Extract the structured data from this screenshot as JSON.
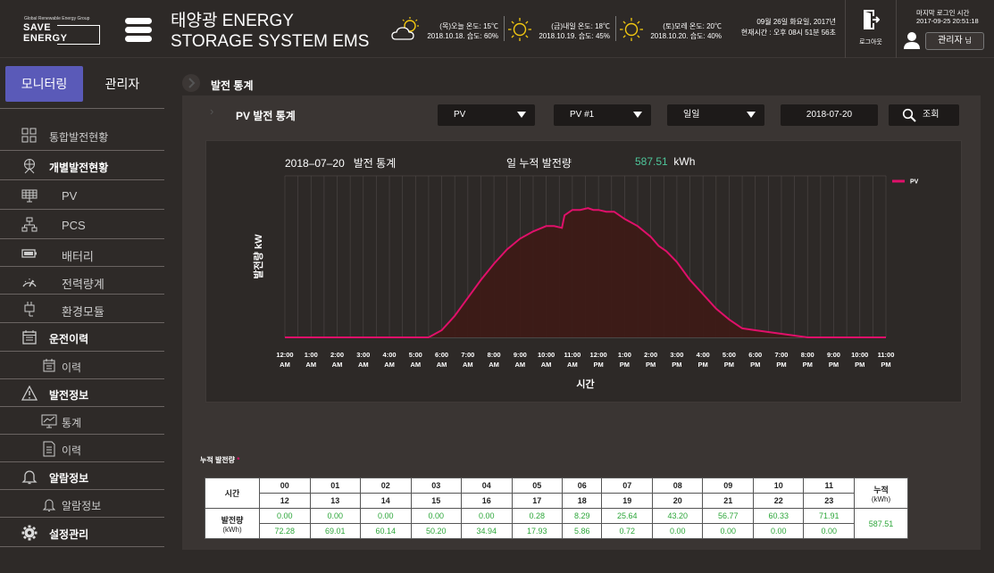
{
  "header": {
    "logo_tagline": "Global Renewable Energy Group",
    "logo_line1": "SAVE",
    "logo_line2": "ENERGY",
    "title_line1": "태양광 ENERGY",
    "title_line2": "STORAGE SYSTEM EMS",
    "weather": [
      {
        "icon": "cloud-sun-icon",
        "line1": "(목)오늘  온도: 15℃",
        "line2": "2018.10.18.  습도: 60%"
      },
      {
        "icon": "sun-icon",
        "line1": "(금)내일  온도: 18℃",
        "line2": "2018.10.19.  습도: 45%"
      },
      {
        "icon": "sun-icon",
        "line1": "(토)모레  온도: 20℃",
        "line2": "2018.10.20.  습도: 40%"
      }
    ],
    "date_line": "09월 26일 화요일, 2017년",
    "time_line": "현재시간 : 오후 08시 51분 56초",
    "logout_label": "로그아웃",
    "last_login_label": "마지막 로그인 시간",
    "last_login_value": "2017-09-25  20:51:18",
    "user_name": "관리자",
    "user_suffix": "님"
  },
  "sidebar": {
    "tab_monitoring": "모니터링",
    "tab_admin": "관리자",
    "items": [
      {
        "label": "통합발전현황",
        "icon": "grid-icon",
        "level": 1,
        "bold": false
      },
      {
        "label": "개별발전현황",
        "icon": "globe-person-icon",
        "level": 1,
        "bold": true
      },
      {
        "label": "PV",
        "icon": "solar-panel-icon",
        "level": 2,
        "bold": false
      },
      {
        "label": "PCS",
        "icon": "network-icon",
        "level": 2,
        "bold": false
      },
      {
        "label": "배터리",
        "icon": "battery-icon",
        "level": 2,
        "bold": false
      },
      {
        "label": "전력량계",
        "icon": "gauge-icon",
        "level": 2,
        "bold": false
      },
      {
        "label": "환경모듈",
        "icon": "plug-icon",
        "level": 2,
        "bold": false
      },
      {
        "label": "운전이력",
        "icon": "calendar-icon",
        "level": 1,
        "bold": true
      },
      {
        "label": "이력",
        "icon": "calendar-small-icon",
        "level": 2,
        "bold": false
      },
      {
        "label": "발전정보",
        "icon": "warning-icon",
        "level": 1,
        "bold": true
      },
      {
        "label": "통계",
        "icon": "chart-monitor-icon",
        "level": 2,
        "bold": false
      },
      {
        "label": "이력",
        "icon": "document-icon",
        "level": 2,
        "bold": false
      },
      {
        "label": "알람정보",
        "icon": "bell-icon",
        "level": 1,
        "bold": true
      },
      {
        "label": "알람정보",
        "icon": "bell-small-icon",
        "level": 2,
        "bold": false
      },
      {
        "label": "설정관리",
        "icon": "gear-icon",
        "level": 1,
        "bold": true
      }
    ]
  },
  "main": {
    "breadcrumb": "발전 통계",
    "subtitle": "PV 발전 통계",
    "filters": {
      "type": "PV",
      "device": "PV #1",
      "period": "일일",
      "date": "2018-07-20",
      "search_label": "조회"
    },
    "chart_title_date": "2018–07–20",
    "chart_title_text": "발전 통계",
    "daily_total_label": "일 누적 발전량",
    "daily_total_value": "587.51",
    "daily_total_unit": "kWh",
    "cum_label": "누적 발전량",
    "cum_mark": "*"
  },
  "chart_data": {
    "type": "area",
    "ylabel": "발전량 kW",
    "xlabel": "시간",
    "legend": "PV",
    "legend_position": "top-right",
    "colors": {
      "line": "#e0106a",
      "fill": "#3d1a16"
    },
    "grid": true,
    "ylim": [
      0,
      90
    ],
    "x_tick_labels": [
      "12:00 AM",
      "1:00 AM",
      "2:00 AM",
      "3:00 AM",
      "4:00 AM",
      "5:00 AM",
      "6:00 AM",
      "7:00 AM",
      "8:00 AM",
      "9:00 AM",
      "10:00 AM",
      "11:00 AM",
      "12:00 PM",
      "1:00 PM",
      "2:00 PM",
      "3:00 PM",
      "4:00 PM",
      "5:00 PM",
      "6:00 PM",
      "7:00 PM",
      "8:00 PM",
      "9:00 PM",
      "10:00 PM",
      "11:00 PM"
    ],
    "series": [
      {
        "name": "PV",
        "x": [
          0,
          1,
          2,
          3,
          4,
          5,
          5.5,
          6,
          6.5,
          7,
          7.5,
          8,
          8.5,
          9,
          9.5,
          10,
          10.3,
          10.6,
          10.7,
          11,
          11.3,
          11.6,
          11.8,
          12,
          12.3,
          12.6,
          13,
          13.5,
          14,
          14.3,
          14.6,
          15,
          15.5,
          16,
          16.5,
          17,
          17.5,
          18,
          18.5,
          19,
          19.5,
          20,
          21,
          22,
          23
        ],
        "y": [
          0,
          0,
          0,
          0,
          0,
          0,
          0,
          4,
          12,
          22,
          32,
          41,
          49,
          55,
          59,
          62,
          62,
          61,
          68,
          71,
          71,
          72,
          71,
          71,
          70,
          70,
          66,
          62,
          56,
          51,
          48,
          42,
          32,
          24,
          16,
          10,
          5,
          4,
          3,
          2,
          1,
          0,
          0,
          0,
          0
        ]
      }
    ]
  },
  "table": {
    "row_header": "시간",
    "value_header_line1": "발전량",
    "value_header_line2": "(kWh)",
    "total_header_line1": "누적",
    "total_header_line2": "(kWh)",
    "total_value": "587.51",
    "hours_top": [
      "00",
      "01",
      "02",
      "03",
      "04",
      "05",
      "06",
      "07",
      "08",
      "09",
      "10",
      "11"
    ],
    "hours_bottom": [
      "12",
      "13",
      "14",
      "15",
      "16",
      "17",
      "18",
      "19",
      "20",
      "21",
      "22",
      "23"
    ],
    "values_top": [
      "0.00",
      "0.00",
      "0.00",
      "0.00",
      "0.00",
      "0.28",
      "8.29",
      "25.64",
      "43.20",
      "56.77",
      "60.33",
      "71.91"
    ],
    "values_bottom": [
      "72.28",
      "69.01",
      "60.14",
      "50.20",
      "34.94",
      "17.93",
      "5.86",
      "0.72",
      "0.00",
      "0.00",
      "0.00",
      "0.00"
    ]
  }
}
